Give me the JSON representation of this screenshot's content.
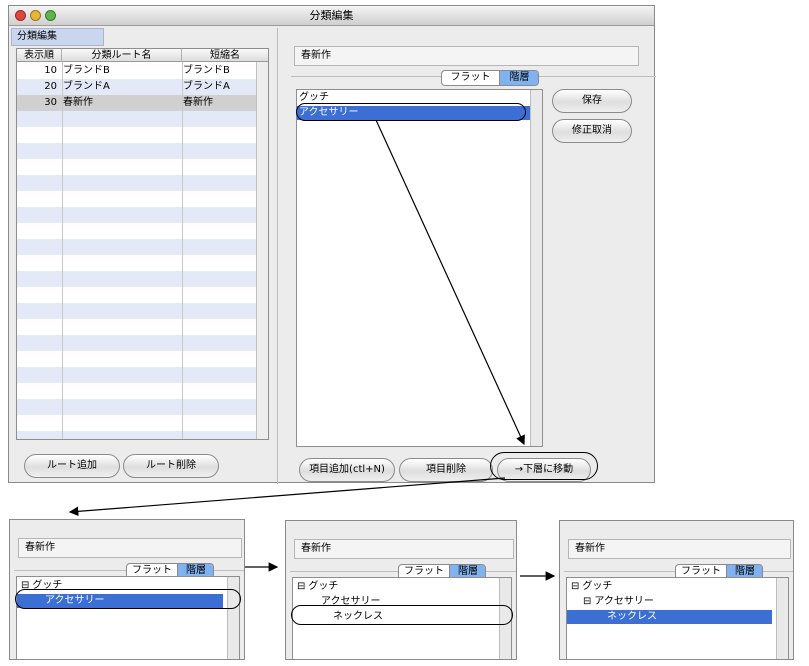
{
  "window": {
    "title": "分類編集",
    "tab_label": "分類編集"
  },
  "left_table": {
    "headers": [
      "表示順",
      "分類ルート名",
      "短縮名"
    ],
    "rows": [
      {
        "order": "10",
        "name": "ブランドB",
        "short": "ブランドB"
      },
      {
        "order": "20",
        "name": "ブランドA",
        "short": "ブランドA"
      },
      {
        "order": "30",
        "name": "春新作",
        "short": "春新作"
      }
    ]
  },
  "left_buttons": {
    "add_root": "ルート追加",
    "delete_root": "ルート削除"
  },
  "right_panel": {
    "category_name": "春新作",
    "view_flat": "フラット",
    "view_hierarchy": "階層",
    "items": [
      "グッチ",
      "アクセサリー"
    ],
    "save": "保存",
    "cancel_edit": "修正取消",
    "add_item": "項目追加(ctl+N)",
    "delete_item": "項目削除",
    "move_down": "→下層に移動"
  },
  "step_panels": [
    {
      "category_name": "春新作",
      "view_flat": "フラット",
      "view_hierarchy": "階層",
      "items": [
        {
          "text": "グッチ",
          "expander": "⊟"
        },
        {
          "text": "アクセサリー",
          "expander": ""
        }
      ]
    },
    {
      "category_name": "春新作",
      "view_flat": "フラット",
      "view_hierarchy": "階層",
      "items": [
        {
          "text": "グッチ",
          "expander": "⊟"
        },
        {
          "text": "アクセサリー",
          "expander": ""
        },
        {
          "text": "ネックレス",
          "expander": ""
        }
      ]
    },
    {
      "category_name": "春新作",
      "view_flat": "フラット",
      "view_hierarchy": "階層",
      "items": [
        {
          "text": "グッチ",
          "expander": "⊟"
        },
        {
          "text": "アクセサリー",
          "expander": "⊟"
        },
        {
          "text": "ネックレス",
          "expander": ""
        }
      ]
    }
  ],
  "colors": {
    "selection": "#3c6fd6",
    "stripe": "#e4e9f7",
    "segment_active": "#7fb2ee"
  }
}
